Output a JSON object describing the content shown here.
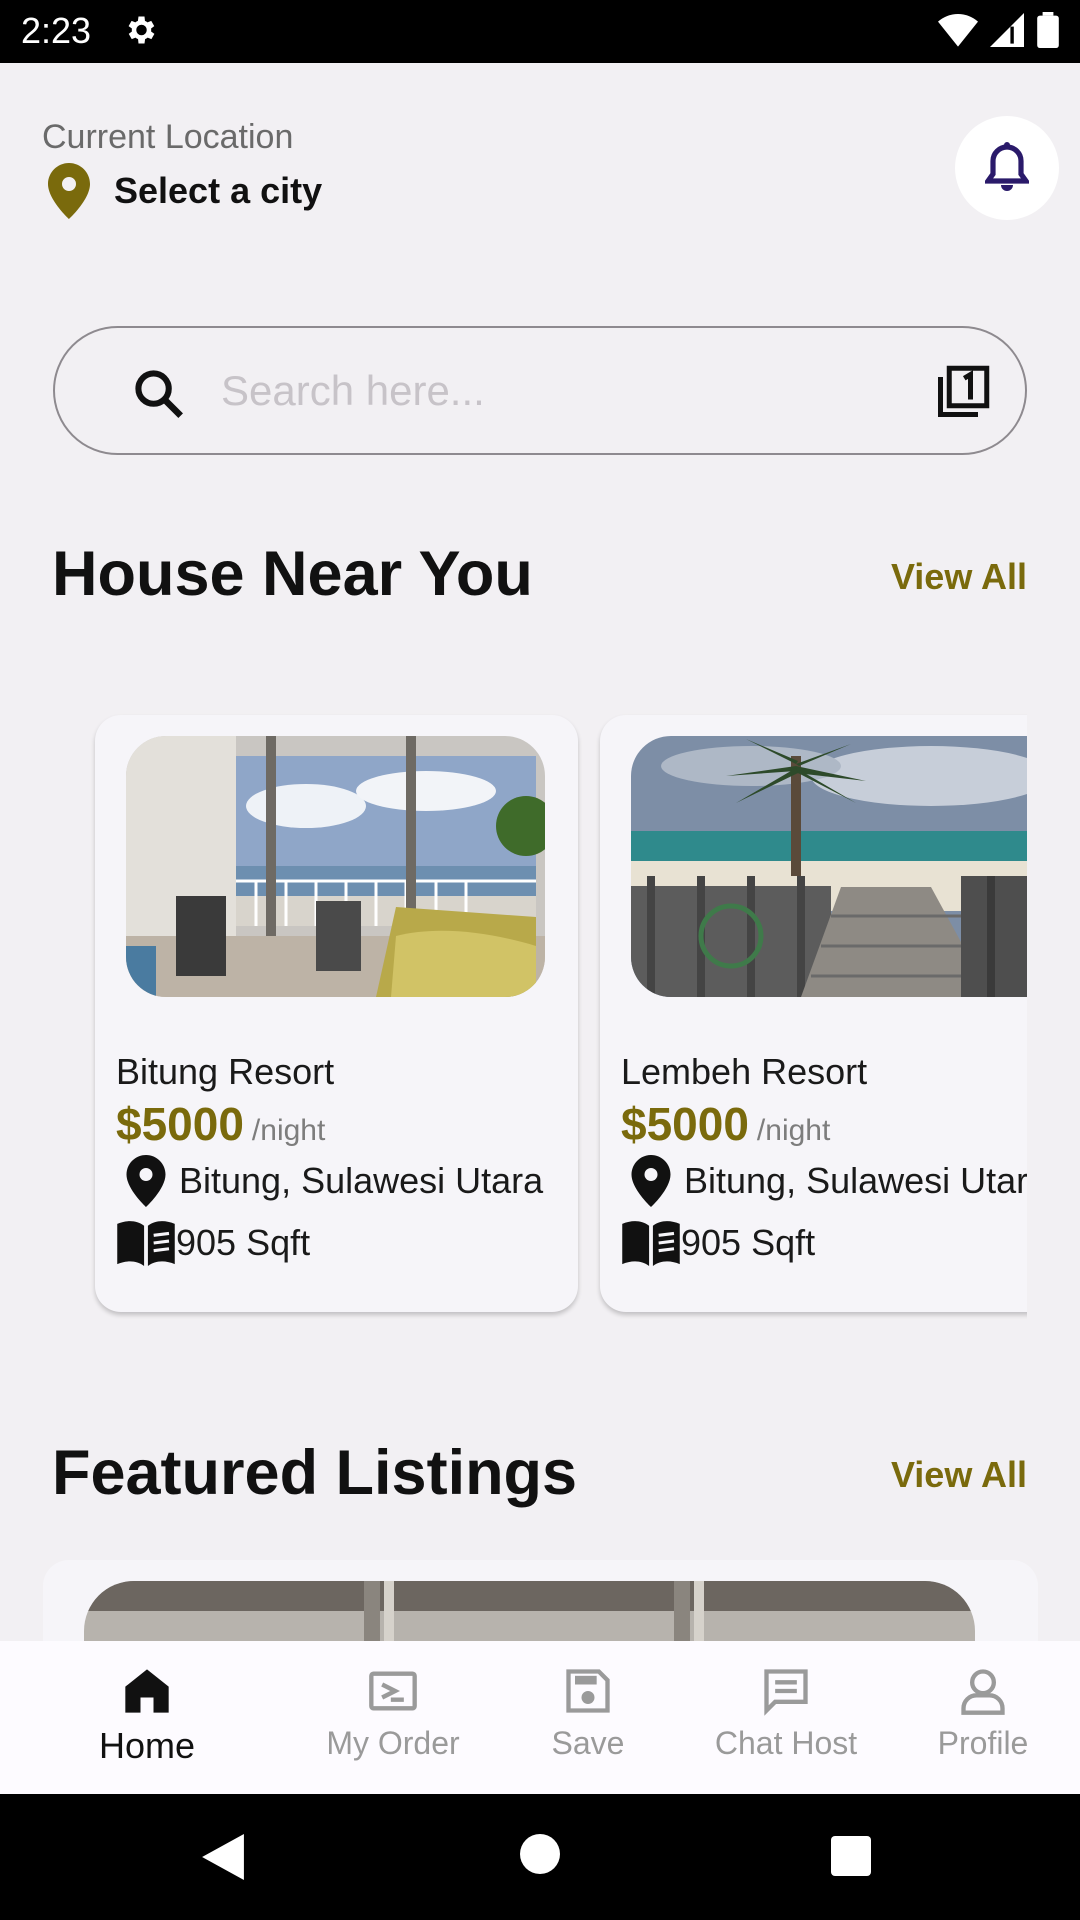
{
  "status_bar": {
    "time": "2:23"
  },
  "header": {
    "location_label": "Current Location",
    "city": "Select a city"
  },
  "search": {
    "placeholder": "Search here..."
  },
  "sections": {
    "near_you": {
      "title": "House Near You",
      "view_all": "View All"
    },
    "featured": {
      "title": "Featured Listings",
      "view_all": "View All"
    }
  },
  "listings": [
    {
      "name": "Bitung Resort",
      "price": "$5000",
      "unit": "/night",
      "location": "Bitung, Sulawesi Utara",
      "size": "905 Sqft"
    },
    {
      "name": "Lembeh Resort",
      "price": "$5000",
      "unit": "/night",
      "location": "Bitung, Sulawesi Utara",
      "size": "905 Sqft"
    }
  ],
  "nav": {
    "items": [
      {
        "label": "Home",
        "icon": "home-icon",
        "active": true
      },
      {
        "label": "My Order",
        "icon": "ticket-icon",
        "active": false
      },
      {
        "label": "Save",
        "icon": "save-icon",
        "active": false
      },
      {
        "label": "Chat Host",
        "icon": "chat-icon",
        "active": false
      },
      {
        "label": "Profile",
        "icon": "profile-icon",
        "active": false
      }
    ]
  },
  "colors": {
    "accent": "#7a6a0c",
    "bell": "#2a1a6a",
    "background": "#f2f0f3"
  }
}
